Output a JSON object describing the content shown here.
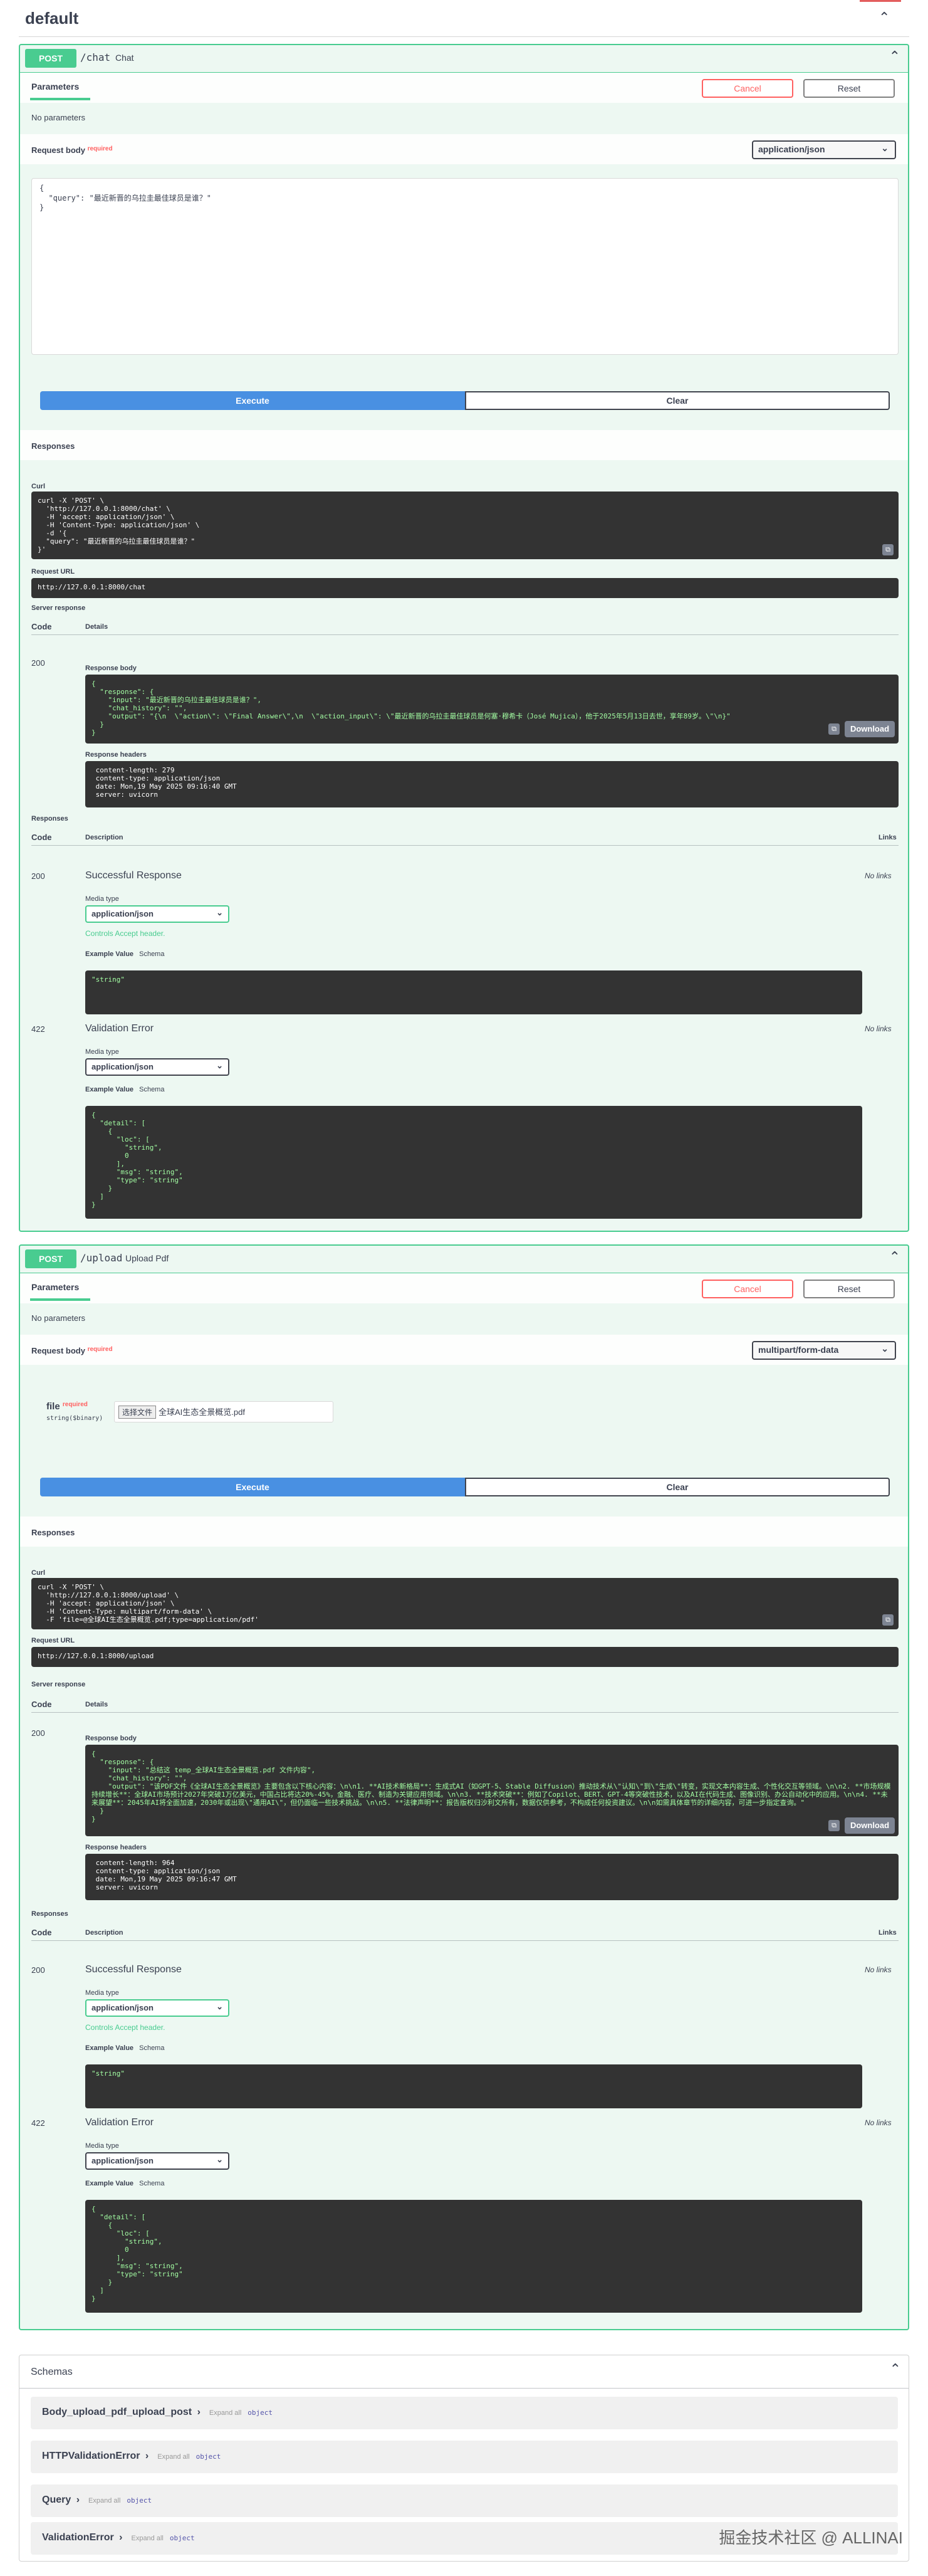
{
  "header": {
    "title": "default"
  },
  "ops": [
    {
      "method": "POST",
      "path": "/chat",
      "summary": "Chat",
      "params_tab": "Parameters",
      "cancel": "Cancel",
      "reset": "Reset",
      "no_params": "No parameters",
      "req_body": "Request body",
      "required": "required",
      "content_type": "application/json",
      "body_lines": "{\n  \"query\": \"最近新晋的乌拉圭最佳球员是谁？\"\n}",
      "execute": "Execute",
      "clear": "Clear",
      "responses_title": "Responses",
      "curl_label": "Curl",
      "curl_lines": "curl -X 'POST' \\\n  'http://127.0.0.1:8000/chat' \\\n  -H 'accept: application/json' \\\n  -H 'Content-Type: application/json' \\\n  -d '{\n  \"query\": \"最近新晋的乌拉圭最佳球员是谁？\"\n}'",
      "req_url_label": "Request URL",
      "req_url": "http://127.0.0.1:8000/chat",
      "server_resp": "Server response",
      "col_code": "Code",
      "col_details": "Details",
      "resp_code": "200",
      "resp_body_label": "Response body",
      "resp_body": "{\n  \"response\": {\n    \"input\": \"最近新晋的乌拉圭最佳球员是谁？\",\n    \"chat_history\": \"\",\n    \"output\": \"{\\n  \\\"action\\\": \\\"Final Answer\\\",\\n  \\\"action_input\\\": \\\"最近新晋的乌拉圭最佳球员是何塞·穆希卡（José Mujica），他于2025年5月13日去世，享年89岁。\\\"\\n}\"\n  }\n}",
      "download": "Download",
      "resp_headers_label": "Response headers",
      "resp_headers": " content-length: 279 \n content-type: application/json \n date: Mon,19 May 2025 09:16:40 GMT \n server: uvicorn ",
      "responses2": "Responses",
      "col_desc": "Description",
      "col_links": "Links",
      "r200": {
        "code": "200",
        "desc": "Successful Response",
        "no_links": "No links",
        "media_type": "Media type",
        "media": "application/json",
        "controls": "Controls Accept header.",
        "example": "Example Value",
        "schema": "Schema",
        "example_code": "\"string\""
      },
      "r422": {
        "code": "422",
        "desc": "Validation Error",
        "no_links": "No links",
        "media_type": "Media type",
        "media": "application/json",
        "example": "Example Value",
        "schema": "Schema",
        "example_code": "{\n  \"detail\": [\n    {\n      \"loc\": [\n        \"string\",\n        0\n      ],\n      \"msg\": \"string\",\n      \"type\": \"string\"\n    }\n  ]\n}"
      }
    },
    {
      "method": "POST",
      "path": "/upload",
      "summary": "Upload Pdf",
      "params_tab": "Parameters",
      "cancel": "Cancel",
      "reset": "Reset",
      "no_params": "No parameters",
      "req_body": "Request body",
      "required": "required",
      "content_type": "multipart/form-data",
      "file_label": "file",
      "file_type": "string($binary)",
      "file_btn": "选择文件",
      "file_name": "全球AI生态全景概览.pdf",
      "execute": "Execute",
      "clear": "Clear",
      "responses_title": "Responses",
      "curl_label": "Curl",
      "curl_lines": "curl -X 'POST' \\\n  'http://127.0.0.1:8000/upload' \\\n  -H 'accept: application/json' \\\n  -H 'Content-Type: multipart/form-data' \\\n  -F 'file=@全球AI生态全景概览.pdf;type=application/pdf'",
      "req_url_label": "Request URL",
      "req_url": "http://127.0.0.1:8000/upload",
      "server_resp": "Server response",
      "col_code": "Code",
      "col_details": "Details",
      "resp_code": "200",
      "resp_body_label": "Response body",
      "resp_body": "{\n  \"response\": {\n    \"input\": \"总结这 temp_全球AI生态全景概览.pdf 文件内容\",\n    \"chat_history\": \"\",\n    \"output\": \"该PDF文件《全球AI生态全景概览》主要包含以下核心内容：\\n\\n1. **AI技术新格局**：生成式AI（如GPT-5、Stable Diffusion）推动技术从\\\"认知\\\"到\\\"生成\\\"转变，实现文本内容生成、个性化交互等领域。\\n\\n2. **市场规模持续增长**：全球AI市场预计2027年突破1万亿美元，中国占比将达20%-45%，金融、医疗、制造为关键应用领域。\\n\\n3. **技术突破**：例如了Copilot、BERT、GPT-4等突破性技术，以及AI在代码生成、图像识别、办公自动化中的应用。\\n\\n4. **未来展望**：2045年AI将全面加速，2030年或出现\\\"通用AI\\\"，但仍面临一些技术挑战。\\n\\n5. **法律声明**：报告版权归沙利文所有，数据仅供参考，不构成任何投资建议。\\n\\n如需具体章节的详细内容，可进一步指定查询。\"\n  }\n}",
      "download": "Download",
      "resp_headers_label": "Response headers",
      "resp_headers": " content-length: 964 \n content-type: application/json \n date: Mon,19 May 2025 09:16:47 GMT \n server: uvicorn ",
      "responses2": "Responses",
      "col_desc": "Description",
      "col_links": "Links",
      "r200": {
        "code": "200",
        "desc": "Successful Response",
        "no_links": "No links",
        "media_type": "Media type",
        "media": "application/json",
        "controls": "Controls Accept header.",
        "example": "Example Value",
        "schema": "Schema",
        "example_code": "\"string\""
      },
      "r422": {
        "code": "422",
        "desc": "Validation Error",
        "no_links": "No links",
        "media_type": "Media type",
        "media": "application/json",
        "example": "Example Value",
        "schema": "Schema",
        "example_code": "{\n  \"detail\": [\n    {\n      \"loc\": [\n        \"string\",\n        0\n      ],\n      \"msg\": \"string\",\n      \"type\": \"string\"\n    }\n  ]\n}"
      }
    }
  ],
  "schemas": {
    "title": "Schemas",
    "expand_all": "Expand all",
    "object": "object",
    "items": [
      "Body_upload_pdf_upload_post",
      "HTTPValidationError",
      "Query",
      "ValidationError"
    ]
  },
  "watermark": "掘金技术社区 @ ALLINAI",
  "colors": {
    "post": "#49cc90",
    "execute": "#4990e2",
    "cancel": "#ff6060"
  }
}
